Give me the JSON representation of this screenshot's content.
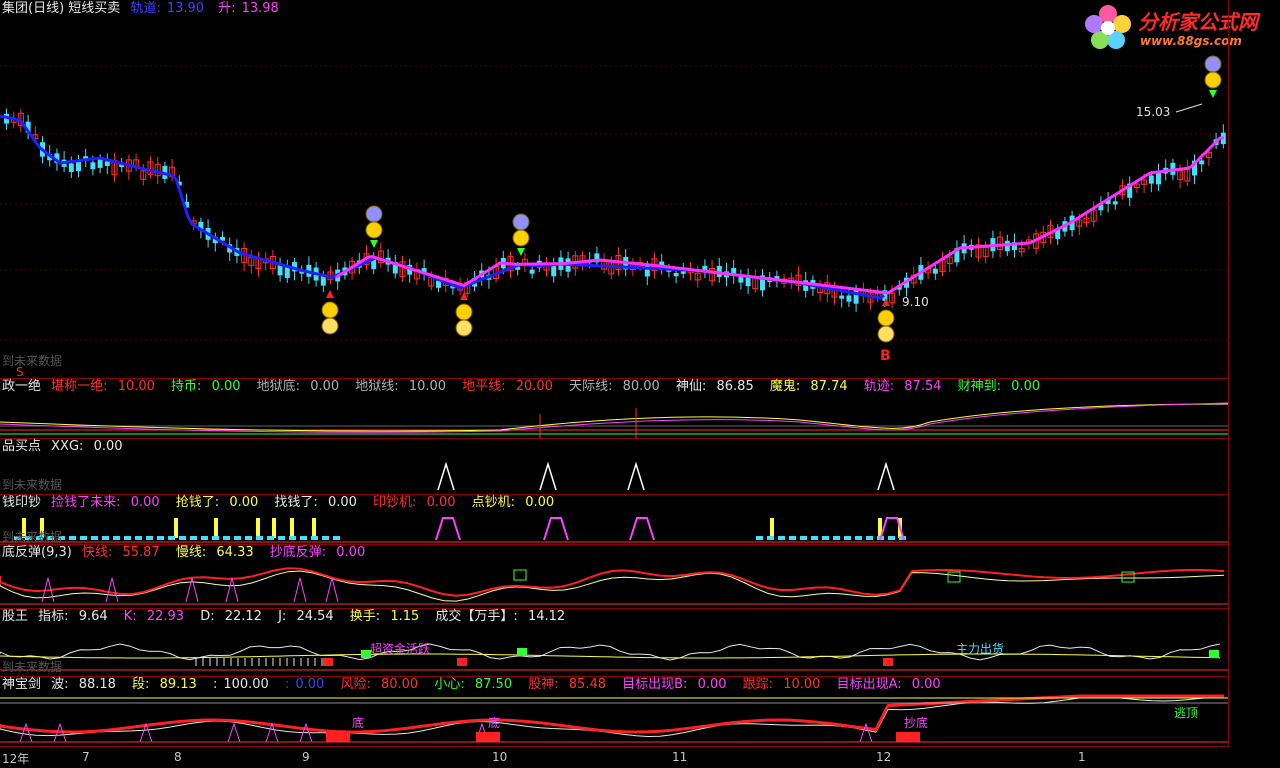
{
  "main": {
    "title": "集团(日线) 短线买卖",
    "guidao_label": "轨道:",
    "guidao_value": "13.90",
    "sheng_label": "升:",
    "sheng_value": "13.98",
    "price_high_label": "15.03",
    "price_low_label": "9.10",
    "buy_marker": "B",
    "sell_marker": "S",
    "watermark": "到未来数据"
  },
  "logo": {
    "name": "分析家公式网",
    "url": "www.88gs.com"
  },
  "panel1": {
    "title": "政一绝",
    "items": [
      {
        "label": "堪称一绝:",
        "value": "10.00"
      },
      {
        "label": "持币:",
        "value": "0.00"
      },
      {
        "label": "地狱底:",
        "value": "0.00"
      },
      {
        "label": "地狱线:",
        "value": "10.00"
      },
      {
        "label": "地平线:",
        "value": "20.00"
      },
      {
        "label": "天际线:",
        "value": "80.00"
      },
      {
        "label": "神仙:",
        "value": "86.85"
      },
      {
        "label": "魔鬼:",
        "value": "87.74"
      },
      {
        "label": "轨迹:",
        "value": "87.54"
      },
      {
        "label": "财神到:",
        "value": "0.00"
      }
    ]
  },
  "panel2": {
    "title": "品买点",
    "items": [
      {
        "label": "XXG:",
        "value": "0.00"
      }
    ],
    "watermark": "到未来数据"
  },
  "panel3": {
    "title": "钱印钞",
    "items": [
      {
        "label": "捡钱了未来:",
        "value": "0.00"
      },
      {
        "label": "抢钱了:",
        "value": "0.00"
      },
      {
        "label": "找钱了:",
        "value": "0.00"
      },
      {
        "label": "印钞机:",
        "value": "0.00"
      },
      {
        "label": "点钞机:",
        "value": "0.00"
      }
    ],
    "watermark": "到未来数据"
  },
  "panel4": {
    "title": "底反弹(9,3)",
    "items": [
      {
        "label": "快线:",
        "value": "55.87"
      },
      {
        "label": "慢线:",
        "value": "64.33"
      },
      {
        "label": "抄底反弹:",
        "value": "0.00"
      }
    ]
  },
  "panel5": {
    "title": "股王",
    "items": [
      {
        "label": "指标:",
        "value": "9.64"
      },
      {
        "label": "K:",
        "value": "22.93"
      },
      {
        "label": "D:",
        "value": "22.12"
      },
      {
        "label": "J:",
        "value": "24.54"
      },
      {
        "label": "换手:",
        "value": "1.15"
      },
      {
        "label": "成交【万手】:",
        "value": "14.12"
      }
    ],
    "annot1": "超资金活跃",
    "annot2": "主力出货",
    "watermark": "到未来数据"
  },
  "panel6": {
    "title": "神宝剑",
    "items": [
      {
        "label": "波:",
        "value": "88.18"
      },
      {
        "label": "段:",
        "value": "89.13"
      },
      {
        "label": ":",
        "value": "100.00"
      },
      {
        "label": ":",
        "value": "0.00"
      },
      {
        "label": "风险:",
        "value": "80.00"
      },
      {
        "label": "小心:",
        "value": "87.50"
      },
      {
        "label": "股神:",
        "value": "85.48"
      },
      {
        "label": "目标出现B:",
        "value": "0.00"
      },
      {
        "label": "跟踪:",
        "value": "10.00"
      },
      {
        "label": "目标出现A:",
        "value": "0.00"
      }
    ],
    "annot_di1": "底",
    "annot_di2": "底",
    "annot_di3": "抄底",
    "annot_top": "逃顶"
  },
  "xaxis": [
    "12年",
    "7",
    "8",
    "9",
    "10",
    "11",
    "12",
    "1"
  ],
  "colors": {
    "up": "#ff3030",
    "down": "#40e0ff",
    "ma_up": "#ff30ff",
    "ma_down": "#2020ff"
  }
}
